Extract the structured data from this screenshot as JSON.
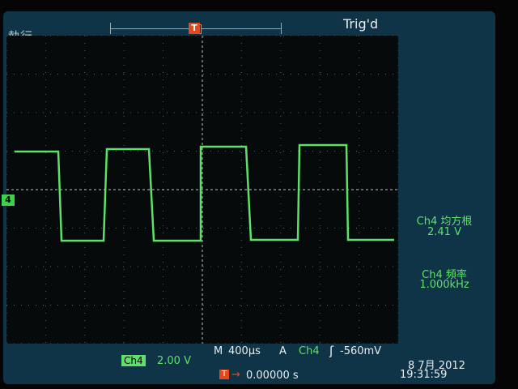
{
  "top": {
    "mode_label": "執行",
    "trigger_status": "Trig'd",
    "trigger_marker": "T"
  },
  "channel": {
    "marker": "4",
    "label": "Ch4",
    "scale": "2.00 V"
  },
  "measurements": [
    {
      "title": "Ch4 均方根",
      "value": "2.41 V"
    },
    {
      "title": "Ch4 頻率",
      "value": "1.000kHz"
    }
  ],
  "horizontal": {
    "label": "M",
    "timebase": "400µs",
    "trigger_label": "A",
    "trigger_channel": "Ch4",
    "trigger_slope_icon": "rising-edge",
    "trigger_level": "-560mV",
    "position": "0.00000 s"
  },
  "datetime": {
    "date": "8 7月 2012",
    "time": "19:31:59"
  },
  "colors": {
    "trace": "#5ee06a",
    "trigger": "#e24a1c"
  }
}
